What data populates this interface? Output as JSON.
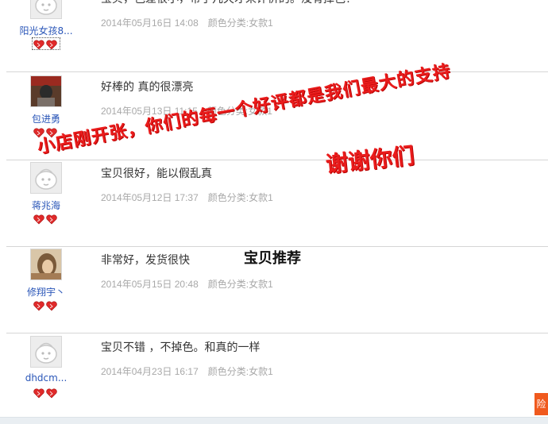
{
  "reviews": [
    {
      "user": "阳光女孩8...",
      "comment": "宝贝，色差很小，带了几天才来评价的。没有掉色！",
      "date": "2014年05月16日 14:08",
      "color": "颜色分类:女款1",
      "avatar": "default-avatar-icon"
    },
    {
      "user": "包进勇",
      "comment": "好棒的 真的很漂亮",
      "date": "2014年05月13日 11:15",
      "color": "颜色分类:女款1",
      "avatar": "photo-avatar"
    },
    {
      "user": "蒋兆海",
      "comment": "宝贝很好，能以假乱真",
      "date": "2014年05月12日 17:37",
      "color": "颜色分类:女款1",
      "avatar": "default-avatar-icon"
    },
    {
      "user": "修翔宇丶",
      "comment": "非常好，发货很快",
      "date": "2014年05月15日 20:48",
      "color": "颜色分类:女款1",
      "avatar": "photo-avatar"
    },
    {
      "user": "dhdcm...",
      "comment": "宝贝不错 ，不掉色。和真的一样",
      "date": "2014年04月23日 16:17",
      "color": "颜色分类:女款1",
      "avatar": "default-avatar-icon"
    }
  ],
  "overlay": {
    "line1": "小店刚开张，你们的每一个好评都是我们最大的支持",
    "line2": "谢谢你们"
  },
  "section_title": "宝贝推荐",
  "corner_button": "险",
  "colors": {
    "username": "#2a56b8",
    "overlay": "#ea1c1c",
    "heart": "#e02a2a",
    "corner": "#f05a1e"
  }
}
